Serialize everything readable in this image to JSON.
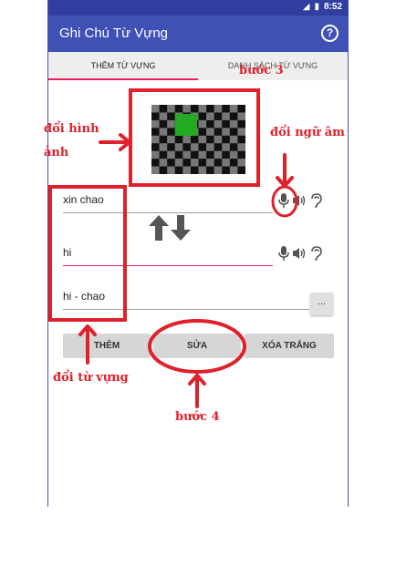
{
  "status_bar": {
    "time": "8:52"
  },
  "app_bar": {
    "title": "Ghi Chú Từ Vựng",
    "help_icon": "help-circle-icon"
  },
  "tabs": [
    {
      "label": "THÊM TỪ VỰNG",
      "active": true
    },
    {
      "label": "DANH SÁCH TỪ VỰNG",
      "active": false
    }
  ],
  "fields": {
    "word": "xin chao",
    "meaning": "hi",
    "combined": "hi - chao"
  },
  "more_button": "...",
  "buttons": {
    "add": "THÊM",
    "edit": "SỬA",
    "clear": "XÓA TRẮNG"
  },
  "annotations": {
    "step3": "bước 3",
    "change_image_line1": "đổi hình",
    "change_image_line2": "ảnh",
    "change_pronunciation": "đổi ngữ âm",
    "change_vocab": "đổi từ vựng",
    "step4": "bước 4"
  },
  "colors": {
    "primary": "#3f51b5",
    "primary_dark": "#303f9f",
    "accent": "#e91e63",
    "annotation": "#e0202a",
    "image_square": "#22aa22"
  }
}
